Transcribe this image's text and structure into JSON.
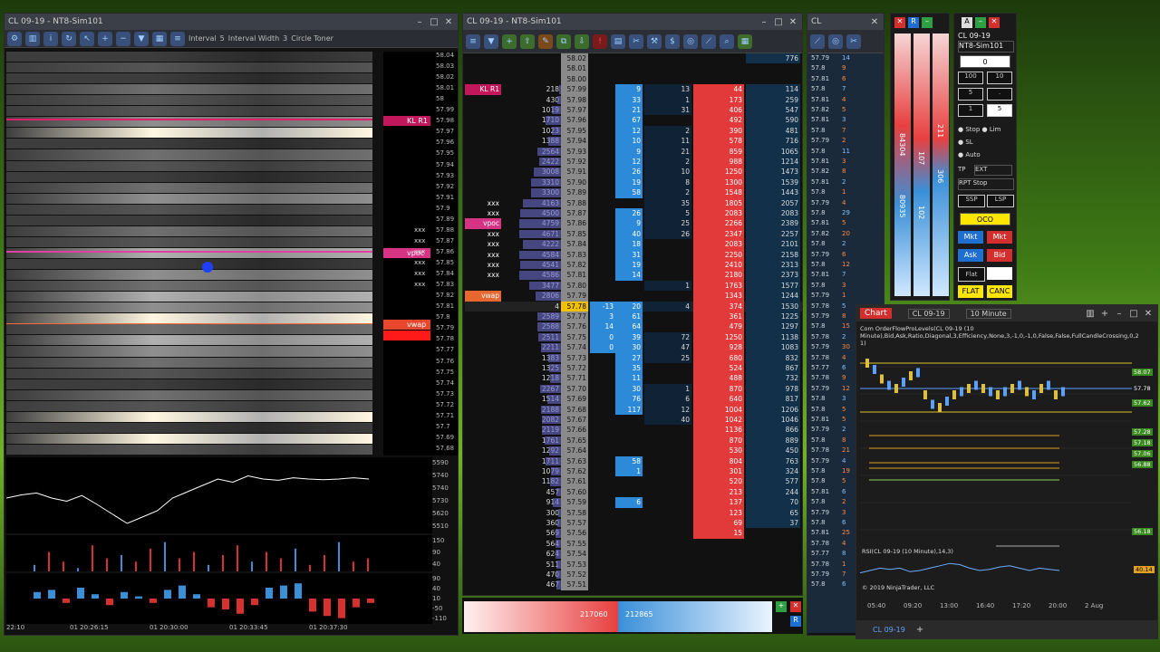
{
  "win1": {
    "title": "CL 09-19 - NT8-Sim101",
    "toolbar": {
      "interval_label": "Interval",
      "interval_value": "5",
      "interval_width_label": "Interval Width",
      "interval_width_value": "3",
      "circle_label": "Circle Toner"
    },
    "price_ticks": [
      "58.04",
      "58.03",
      "58.02",
      "58.01",
      "58",
      "57.99",
      "57.98",
      "57.97",
      "57.96",
      "57.95",
      "57.94",
      "57.93",
      "57.92",
      "57.91",
      "57.9",
      "57.89",
      "57.88",
      "57.87",
      "57.86",
      "57.85",
      "57.84",
      "57.83",
      "57.82",
      "57.81",
      "57.8",
      "57.79",
      "57.78",
      "57.77",
      "57.76",
      "57.75",
      "57.74",
      "57.73",
      "57.72",
      "57.71",
      "57.7",
      "57.69",
      "57.68"
    ],
    "tags": {
      "klr": "KL R1",
      "vpoc": "vpoc",
      "vwap": "vwap"
    },
    "xxx_label": "xxx",
    "line_axis": [
      "5590",
      "5740",
      "5740",
      "5730",
      "5620",
      "5510"
    ],
    "vol_axis": [
      "150",
      "90",
      "40"
    ],
    "delta_axis": [
      "90",
      "40",
      "10",
      "-50",
      "-110"
    ],
    "time_labels": [
      "22:10",
      "01 20:26:15",
      "01 20:30:00",
      "01 20:33:45",
      "01 20:37:30"
    ],
    "heat_colors": [
      "#2a2a2a",
      "#3d3d3d",
      "#555",
      "#707070",
      "#8f8f8f",
      "#b0b0b0",
      "#fff7e0"
    ],
    "heat_levels": [
      1,
      2,
      1,
      3,
      2,
      2,
      4,
      6,
      1,
      3,
      2,
      1,
      3,
      4,
      2,
      1,
      3,
      2,
      5,
      1,
      4,
      3,
      5,
      4,
      6,
      3,
      5,
      4,
      3,
      2,
      1,
      3,
      2,
      6,
      1,
      6,
      2
    ],
    "line_points": [
      0.5,
      0.45,
      0.42,
      0.5,
      0.55,
      0.46,
      0.6,
      0.75,
      0.9,
      0.8,
      0.7,
      0.5,
      0.4,
      0.3,
      0.2,
      0.25,
      0.15,
      0.2,
      0.22,
      0.18,
      0.2,
      0.21,
      0.2,
      0.18,
      0.2
    ],
    "vol_values": [
      0.2,
      0.6,
      0.3,
      0.1,
      0.8,
      0.4,
      0.5,
      0.3,
      0.7,
      0.9,
      0.4,
      0.6,
      0.2,
      0.5,
      0.8,
      0.3,
      0.6,
      0.4,
      0.7,
      0.2,
      0.5,
      0.9,
      0.3,
      0.4
    ],
    "delta_values": [
      0.3,
      0.4,
      -0.2,
      0.5,
      0.2,
      -0.3,
      0.3,
      0.1,
      -0.2,
      0.4,
      0.6,
      0.2,
      -0.4,
      -0.5,
      -0.7,
      -0.3,
      0.5,
      0.6,
      0.7,
      -0.6,
      -0.8,
      -0.9,
      -0.4,
      -0.2
    ]
  },
  "win2": {
    "title": "CL 09-19 - NT8-Sim101",
    "rows": [
      {
        "p": "58.02",
        "v": "",
        "b": "",
        "a": "",
        "s": "",
        "r": "",
        "t": "776",
        "tag": ""
      },
      {
        "p": "58.01",
        "v": "",
        "b": "",
        "a": "",
        "s": "",
        "r": "",
        "t": "",
        "tag": ""
      },
      {
        "p": "58.00",
        "v": "",
        "b": "",
        "a": "",
        "s": "",
        "r": "",
        "t": "",
        "tag": ""
      },
      {
        "p": "57.99",
        "v": "218",
        "b": "",
        "a": "9",
        "s": "13",
        "r": "44",
        "t": "114",
        "tag": "KL R1"
      },
      {
        "p": "57.98",
        "v": "430",
        "b": "",
        "a": "33",
        "s": "1",
        "r": "173",
        "t": "259",
        "tag": ""
      },
      {
        "p": "57.97",
        "v": "1019",
        "b": "",
        "a": "21",
        "s": "31",
        "r": "406",
        "t": "547",
        "tag": ""
      },
      {
        "p": "57.96",
        "v": "1710",
        "b": "",
        "a": "67",
        "s": "",
        "r": "492",
        "t": "590",
        "tag": ""
      },
      {
        "p": "57.95",
        "v": "1023",
        "b": "",
        "a": "12",
        "s": "2",
        "r": "390",
        "t": "481",
        "tag": ""
      },
      {
        "p": "57.94",
        "v": "1388",
        "b": "",
        "a": "10",
        "s": "11",
        "r": "578",
        "t": "716",
        "tag": ""
      },
      {
        "p": "57.93",
        "v": "2564",
        "b": "",
        "a": "9",
        "s": "21",
        "r": "859",
        "t": "1065",
        "tag": ""
      },
      {
        "p": "57.92",
        "v": "2422",
        "b": "",
        "a": "12",
        "s": "2",
        "r": "988",
        "t": "1214",
        "tag": ""
      },
      {
        "p": "57.91",
        "v": "3008",
        "b": "",
        "a": "26",
        "s": "10",
        "r": "1250",
        "t": "1473",
        "tag": ""
      },
      {
        "p": "57.90",
        "v": "3310",
        "b": "",
        "a": "19",
        "s": "8",
        "r": "1300",
        "t": "1539",
        "tag": ""
      },
      {
        "p": "57.89",
        "v": "3300",
        "b": "",
        "a": "58",
        "s": "2",
        "r": "1548",
        "t": "1443",
        "tag": ""
      },
      {
        "p": "57.88",
        "v": "4163",
        "b": "",
        "a": "",
        "s": "35",
        "r": "1805",
        "t": "2057",
        "tag": "xxx"
      },
      {
        "p": "57.87",
        "v": "4500",
        "b": "",
        "a": "26",
        "s": "5",
        "r": "2083",
        "t": "2083",
        "tag": "xxx"
      },
      {
        "p": "57.86",
        "v": "4759",
        "b": "",
        "a": "9",
        "s": "25",
        "r": "2266",
        "t": "2389",
        "tag": "vpoc"
      },
      {
        "p": "57.85",
        "v": "4671",
        "b": "",
        "a": "40",
        "s": "26",
        "r": "2347",
        "t": "2257",
        "tag": "xxx"
      },
      {
        "p": "57.84",
        "v": "4222",
        "b": "",
        "a": "18",
        "s": "",
        "r": "2083",
        "t": "2101",
        "tag": "xxx"
      },
      {
        "p": "57.83",
        "v": "4584",
        "b": "",
        "a": "31",
        "s": "",
        "r": "2250",
        "t": "2158",
        "tag": "xxx"
      },
      {
        "p": "57.82",
        "v": "4541",
        "b": "",
        "a": "19",
        "s": "",
        "r": "2410",
        "t": "2313",
        "tag": "xxx"
      },
      {
        "p": "57.81",
        "v": "4586",
        "b": "",
        "a": "14",
        "s": "",
        "r": "2180",
        "t": "2373",
        "tag": "xxx"
      },
      {
        "p": "57.80",
        "v": "3477",
        "b": "",
        "a": "",
        "s": "1",
        "r": "1763",
        "t": "1577",
        "tag": ""
      },
      {
        "p": "57.79",
        "v": "2806",
        "b": "",
        "a": "",
        "s": "",
        "r": "1343",
        "t": "1244",
        "tag": "vwap"
      },
      {
        "p": "57.78",
        "v": "4",
        "b": "-13",
        "a": "20",
        "s": "4",
        "r": "374",
        "t": "1530",
        "tag": ""
      },
      {
        "p": "57.77",
        "v": "2589",
        "b": "3",
        "a": "61",
        "s": "",
        "r": "361",
        "t": "1225",
        "tag": ""
      },
      {
        "p": "57.76",
        "v": "2588",
        "b": "14",
        "a": "64",
        "s": "",
        "r": "479",
        "t": "1297",
        "tag": ""
      },
      {
        "p": "57.75",
        "v": "2511",
        "b": "0",
        "a": "39",
        "s": "72",
        "r": "1250",
        "t": "1138",
        "tag": ""
      },
      {
        "p": "57.74",
        "v": "2211",
        "b": "0",
        "a": "30",
        "s": "47",
        "r": "928",
        "t": "1083",
        "tag": ""
      },
      {
        "p": "57.73",
        "v": "1383",
        "b": "",
        "a": "27",
        "s": "25",
        "r": "680",
        "t": "832",
        "tag": ""
      },
      {
        "p": "57.72",
        "v": "1325",
        "b": "",
        "a": "35",
        "s": "",
        "r": "524",
        "t": "867",
        "tag": ""
      },
      {
        "p": "57.71",
        "v": "1218",
        "b": "",
        "a": "11",
        "s": "",
        "r": "488",
        "t": "732",
        "tag": ""
      },
      {
        "p": "57.70",
        "v": "2267",
        "b": "",
        "a": "30",
        "s": "1",
        "r": "870",
        "t": "978",
        "tag": ""
      },
      {
        "p": "57.69",
        "v": "1514",
        "b": "",
        "a": "76",
        "s": "6",
        "r": "640",
        "t": "817",
        "tag": ""
      },
      {
        "p": "57.68",
        "v": "2188",
        "b": "",
        "a": "117",
        "s": "12",
        "r": "1004",
        "t": "1206",
        "tag": ""
      },
      {
        "p": "57.67",
        "v": "2082",
        "b": "",
        "a": "",
        "s": "40",
        "r": "1042",
        "t": "1046",
        "tag": ""
      },
      {
        "p": "57.66",
        "v": "2119",
        "b": "",
        "a": "",
        "s": "",
        "r": "1136",
        "t": "866",
        "tag": ""
      },
      {
        "p": "57.65",
        "v": "1761",
        "b": "",
        "a": "",
        "s": "",
        "r": "870",
        "t": "889",
        "tag": ""
      },
      {
        "p": "57.64",
        "v": "1292",
        "b": "",
        "a": "",
        "s": "",
        "r": "530",
        "t": "450",
        "tag": ""
      },
      {
        "p": "57.63",
        "v": "1711",
        "b": "",
        "a": "58",
        "s": "",
        "r": "804",
        "t": "763",
        "tag": ""
      },
      {
        "p": "57.62",
        "v": "1079",
        "b": "",
        "a": "1",
        "s": "",
        "r": "301",
        "t": "324",
        "tag": ""
      },
      {
        "p": "57.61",
        "v": "1182",
        "b": "",
        "a": "",
        "s": "",
        "r": "520",
        "t": "577",
        "tag": ""
      },
      {
        "p": "57.60",
        "v": "457",
        "b": "",
        "a": "",
        "s": "",
        "r": "213",
        "t": "244",
        "tag": ""
      },
      {
        "p": "57.59",
        "v": "914",
        "b": "",
        "a": "6",
        "s": "",
        "r": "137",
        "t": "70",
        "tag": ""
      },
      {
        "p": "57.58",
        "v": "300",
        "b": "",
        "a": "",
        "s": "",
        "r": "123",
        "t": "65",
        "tag": ""
      },
      {
        "p": "57.57",
        "v": "360",
        "b": "",
        "a": "",
        "s": "",
        "r": "69",
        "t": "37",
        "tag": ""
      },
      {
        "p": "57.56",
        "v": "569",
        "b": "",
        "a": "",
        "s": "",
        "r": "15",
        "t": "",
        "tag": ""
      },
      {
        "p": "57.55",
        "v": "564",
        "b": "",
        "a": "",
        "s": "",
        "r": "",
        "t": "",
        "tag": ""
      },
      {
        "p": "57.54",
        "v": "624",
        "b": "",
        "a": "",
        "s": "",
        "r": "",
        "t": "",
        "tag": ""
      },
      {
        "p": "57.53",
        "v": "511",
        "b": "",
        "a": "",
        "s": "",
        "r": "",
        "t": "",
        "tag": ""
      },
      {
        "p": "57.52",
        "v": "470",
        "b": "",
        "a": "",
        "s": "",
        "r": "",
        "t": "",
        "tag": ""
      },
      {
        "p": "57.51",
        "v": "467",
        "b": "",
        "a": "",
        "s": "",
        "r": "",
        "t": "",
        "tag": ""
      }
    ],
    "bottom_left": "217060",
    "bottom_right": "212865"
  },
  "win3": {
    "title": "CL",
    "rows": [
      [
        "57.79",
        "14"
      ],
      [
        "57.8",
        "9"
      ],
      [
        "57.81",
        "6"
      ],
      [
        "57.8",
        "7"
      ],
      [
        "57.81",
        "4"
      ],
      [
        "57.82",
        "5"
      ],
      [
        "57.81",
        "3"
      ],
      [
        "57.8",
        "7"
      ],
      [
        "57.79",
        "2"
      ],
      [
        "57.8",
        "11"
      ],
      [
        "57.81",
        "3"
      ],
      [
        "57.82",
        "8"
      ],
      [
        "57.81",
        "2"
      ],
      [
        "57.8",
        "1"
      ],
      [
        "57.79",
        "4"
      ],
      [
        "57.8",
        "29"
      ],
      [
        "57.81",
        "5"
      ],
      [
        "57.82",
        "20"
      ],
      [
        "57.8",
        "2"
      ],
      [
        "57.79",
        "6"
      ],
      [
        "57.8",
        "12"
      ],
      [
        "57.81",
        "7"
      ],
      [
        "57.8",
        "3"
      ],
      [
        "57.79",
        "1"
      ],
      [
        "57.78",
        "5"
      ],
      [
        "57.79",
        "8"
      ],
      [
        "57.8",
        "15"
      ],
      [
        "57.78",
        "2"
      ],
      [
        "57.79",
        "30"
      ],
      [
        "57.78",
        "4"
      ],
      [
        "57.77",
        "6"
      ],
      [
        "57.78",
        "9"
      ],
      [
        "57.79",
        "12"
      ],
      [
        "57.8",
        "3"
      ],
      [
        "57.8",
        "5"
      ],
      [
        "57.81",
        "5"
      ],
      [
        "57.79",
        "2"
      ],
      [
        "57.8",
        "8"
      ],
      [
        "57.78",
        "21"
      ],
      [
        "57.79",
        "4"
      ],
      [
        "57.8",
        "19"
      ],
      [
        "57.8",
        "5"
      ],
      [
        "57.81",
        "6"
      ],
      [
        "57.8",
        "2"
      ],
      [
        "57.79",
        "3"
      ],
      [
        "57.8",
        "6"
      ],
      [
        "57.81",
        "25"
      ],
      [
        "57.78",
        "4"
      ],
      [
        "57.77",
        "8"
      ],
      [
        "57.78",
        "1"
      ],
      [
        "57.79",
        "7"
      ],
      [
        "57.8",
        "6"
      ]
    ]
  },
  "order": {
    "bid_qty": "84304",
    "ask_qty": "80935",
    "mid1": "107",
    "mid2": "102",
    "right1": "211",
    "right2": "306",
    "instrument": "CL 09-19",
    "account": "NT8-Sim101",
    "qty_values": [
      "0",
      "100",
      "10",
      "5",
      "1",
      "5"
    ],
    "stop_label": "Stop",
    "lim_label": "Lim",
    "sl_label": "SL",
    "auto_label": "Auto",
    "tp_label": "TP",
    "tp_value": "EXT",
    "atm": "RPT Stop",
    "ssp": "SSP",
    "lsp": "LSP",
    "oco": "OCO",
    "mkt_buy": "Mkt",
    "mkt_sell": "Mkt",
    "ask": "Ask",
    "bid": "Bid",
    "flat_label": "Flat",
    "flat": "FLAT",
    "canc": "CANC"
  },
  "chart": {
    "title": "Chart",
    "instrument": "CL 09-19",
    "interval": "10 Minute",
    "indicator_line1": "Com OrderFlowProLevels(CL 09-19 (10",
    "indicator_line2": "Minute),Bid,Ask,Ratio,Diagonal,3,Efficiency,None,3,-1,0,-1,0,False,False,FullCandleCrossing,0,2",
    "indicator_line3": "1)",
    "price_labels": [
      "58.07",
      "57.78",
      "57.62",
      "57.28",
      "57.18",
      "57.06",
      "56.88",
      "56.18"
    ],
    "sub_label": "RSI(CL 09-19 (10 Minute),14,3)",
    "sub_value": "40.14",
    "copyright": "© 2019 NinjaTrader, LLC",
    "time_labels": [
      "05:40",
      "09:20",
      "13:00",
      "16:40",
      "17:20",
      "20:00",
      "2 Aug"
    ],
    "tab": "CL 09-19",
    "price_series": [
      0.1,
      0.2,
      0.35,
      0.45,
      0.5,
      0.4,
      0.3,
      0.25,
      0.6,
      0.75,
      0.8,
      0.7,
      0.6,
      0.55,
      0.5,
      0.45,
      0.5,
      0.55,
      0.6,
      0.55,
      0.5,
      0.45,
      0.55,
      0.6,
      0.5,
      0.45,
      0.6,
      0.55
    ],
    "rsi_series": [
      0.4,
      0.5,
      0.6,
      0.55,
      0.6,
      0.45,
      0.5,
      0.6,
      0.7,
      0.8,
      0.75,
      0.6,
      0.5,
      0.55,
      0.65,
      0.7,
      0.6,
      0.5,
      0.6,
      0.55,
      0.5
    ]
  }
}
